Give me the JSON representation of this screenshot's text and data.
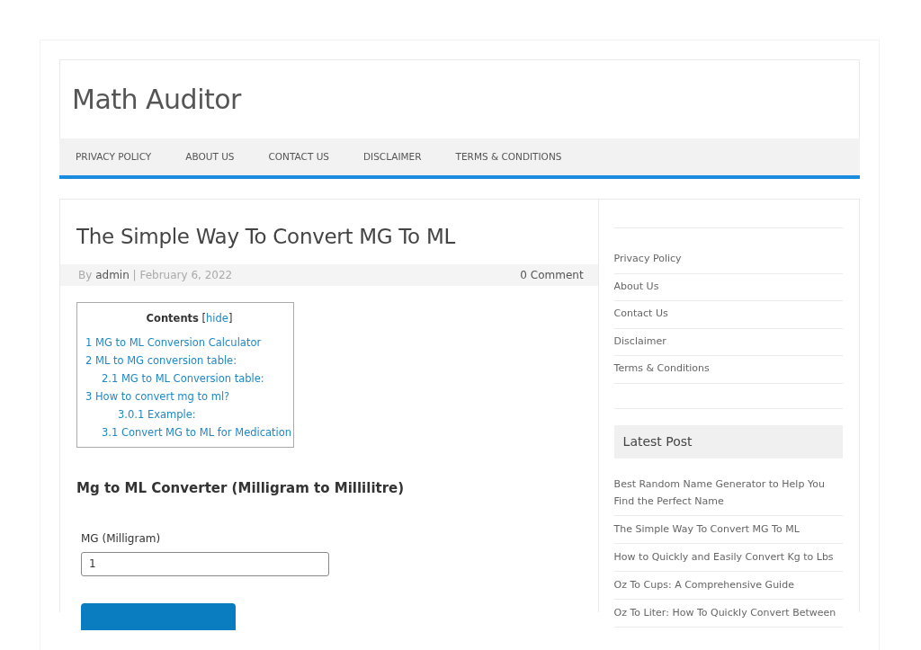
{
  "site": {
    "title": "Math Auditor"
  },
  "menu": [
    {
      "label": "PRIVACY POLICY"
    },
    {
      "label": "ABOUT US"
    },
    {
      "label": "CONTACT US"
    },
    {
      "label": "DISCLAIMER"
    },
    {
      "label": "TERMS & CONDITIONS"
    }
  ],
  "article": {
    "title": "The Simple Way To Convert MG To ML",
    "by": "By",
    "author": "admin",
    "separator": "|",
    "date": "February 6, 2022",
    "comments": "0 Comment",
    "toc": {
      "title": "Contents",
      "open_bracket": "[",
      "toggle": "hide",
      "close_bracket": "]",
      "items": [
        {
          "label": "1 MG to ML Conversion Calculator"
        },
        {
          "label": "2 ML to MG conversion table:",
          "children": [
            {
              "label": "2.1 MG to ML Conversion table:"
            }
          ]
        },
        {
          "label": "3 How to convert mg to ml?",
          "children": [
            {
              "children": [
                {
                  "label": "3.0.1 Example:"
                }
              ]
            },
            {
              "label": "3.1 Convert MG to ML for Medication"
            }
          ]
        }
      ]
    },
    "converter": {
      "heading": "Mg to ML Converter (Milligram to Millilitre)",
      "field_label": "MG (Milligram)",
      "value": "1"
    }
  },
  "sidebar": {
    "pages": [
      {
        "label": "Privacy Policy"
      },
      {
        "label": "About Us"
      },
      {
        "label": "Contact Us"
      },
      {
        "label": "Disclaimer"
      },
      {
        "label": "Terms & Conditions"
      }
    ],
    "latest_title": "Latest Post",
    "latest": [
      {
        "label": "Best Random Name Generator to Help You Find the Perfect Name"
      },
      {
        "label": "The Simple Way To Convert MG To ML"
      },
      {
        "label": "How to Quickly and Easily Convert Kg to Lbs"
      },
      {
        "label": "Oz To Cups: A Comprehensive Guide"
      },
      {
        "label": "Oz To Liter: How To Quickly Convert Between"
      }
    ]
  }
}
